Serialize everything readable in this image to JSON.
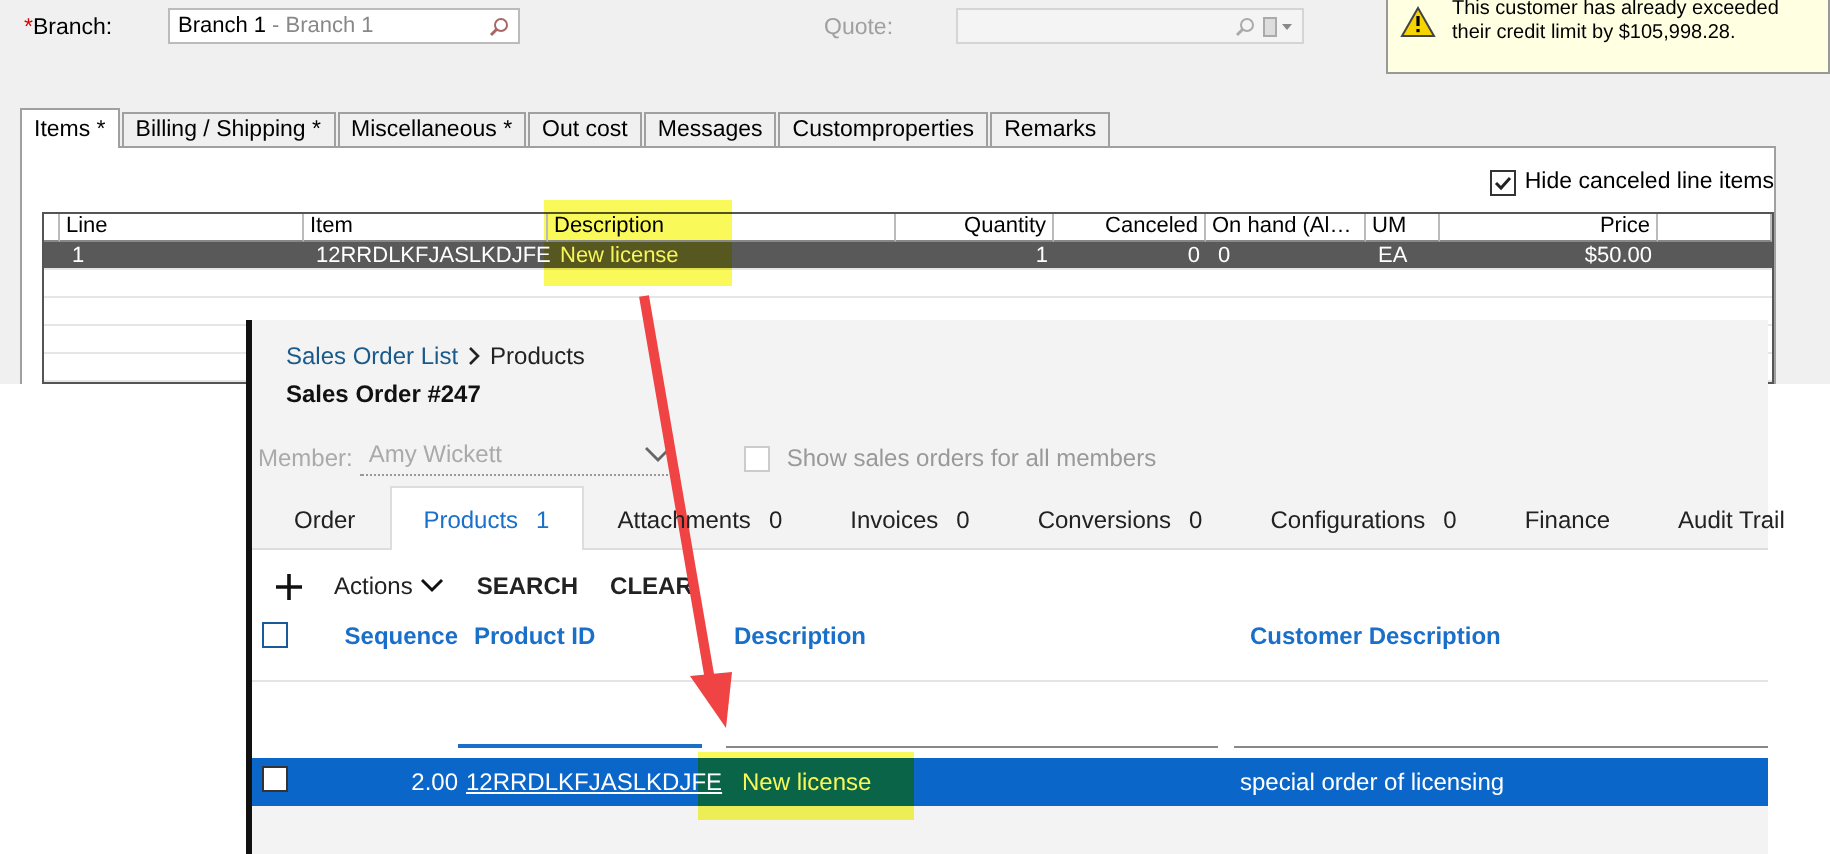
{
  "branch": {
    "required_mark": "*",
    "label": "Branch:",
    "value": "Branch 1",
    "description": "- Branch 1"
  },
  "quote": {
    "label": "Quote:",
    "disabled": true
  },
  "credit_warning": {
    "text": "This customer has already exceeded their credit limit by $105,998.28."
  },
  "legacy_tabs": [
    {
      "label": "Items *",
      "selected": true
    },
    {
      "label": "Billing / Shipping  *",
      "selected": false
    },
    {
      "label": "Miscellaneous *",
      "selected": false
    },
    {
      "label": "Out cost",
      "selected": false
    },
    {
      "label": "Messages",
      "selected": false
    },
    {
      "label": "Customproperties",
      "selected": false
    },
    {
      "label": "Remarks",
      "selected": false
    }
  ],
  "hide_canceled": {
    "label": "Hide canceled line items",
    "checked": true
  },
  "legacy_grid": {
    "columns": [
      "Line",
      "Item",
      "Description",
      "Quantity",
      "Canceled",
      "On hand (Al…",
      "UM",
      "Price"
    ],
    "rows": [
      {
        "selected": true,
        "cells": [
          "1",
          "12RRDLKFJASLKDJFE",
          "New license",
          "1",
          "0",
          "0",
          "EA",
          "$50.00"
        ]
      }
    ]
  },
  "inset": {
    "breadcrumb": [
      "Sales Order List",
      "Products"
    ],
    "title": "Sales Order #247",
    "member": {
      "label": "Member:",
      "value": "Amy Wickett",
      "disabled": true
    },
    "all_members": {
      "label": "Show sales orders for all members",
      "checked": false,
      "disabled": true
    },
    "tabs": [
      {
        "label": "Order",
        "selected": false
      },
      {
        "label": "Products",
        "count": "1",
        "selected": true
      },
      {
        "label": "Attachments",
        "count": "0",
        "selected": false
      },
      {
        "label": "Invoices",
        "count": "0",
        "selected": false
      },
      {
        "label": "Conversions",
        "count": "0",
        "selected": false
      },
      {
        "label": "Configurations",
        "count": "0",
        "selected": false
      },
      {
        "label": "Finance",
        "selected": false
      },
      {
        "label": "Audit Trail",
        "selected": false
      }
    ],
    "toolbar": {
      "actions": "Actions",
      "buttons": [
        "SEARCH",
        "CLEAR"
      ]
    },
    "table": {
      "select_all": false,
      "columns": [
        "Sequence",
        "Product ID",
        "Description",
        "Customer Description"
      ],
      "rows": [
        {
          "selected": true,
          "checked": false,
          "sequence": "2.00",
          "product_id": "12RRDLKFJASLKDJFE",
          "description": "New license",
          "customer_description": "special order of licensing"
        }
      ]
    }
  }
}
